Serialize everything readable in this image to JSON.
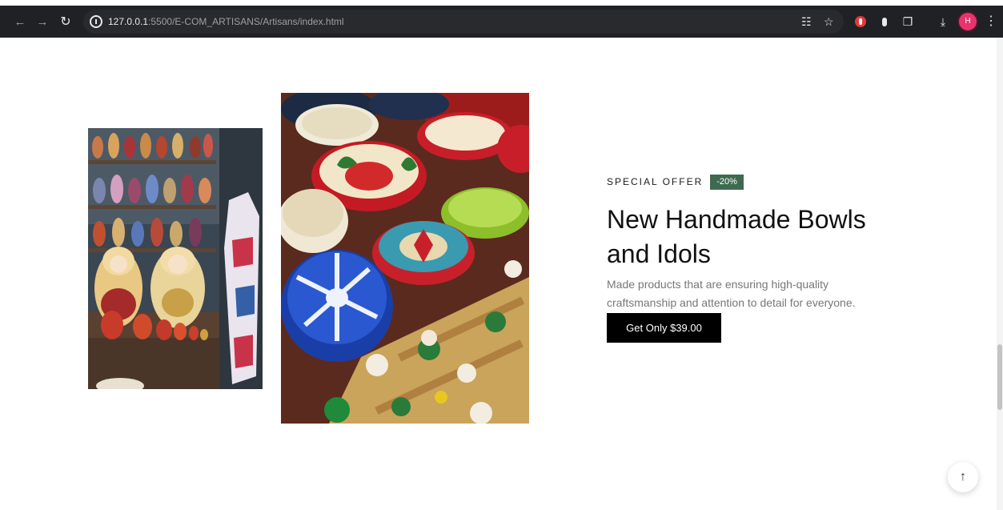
{
  "browser": {
    "url_host": "127.0.0.1",
    "url_path": ":5500/E-COM_ARTISANS/Artisans/index.html",
    "icons": [
      "back-icon",
      "forward-icon",
      "reload-icon",
      "site-info-icon",
      "translate-icon",
      "bookmark-star-icon",
      "extension-icon",
      "puzzle-extensions-icon",
      "download-icon",
      "profile-avatar",
      "kebab-menu-icon"
    ],
    "avatar_initial": "H"
  },
  "hero": {
    "offer_label": "SPECIAL OFFER",
    "discount_badge": "-20%",
    "headline": "New Handmade Bowls and Idols",
    "description": "Made products that are ensuring high-quality craftsmanship and attention to detail for everyone.",
    "cta_label": "Get Only $39.00"
  },
  "colors": {
    "badge_bg": "#3f6a50",
    "cta_bg": "#000000",
    "toolbar_bg": "#202124"
  }
}
